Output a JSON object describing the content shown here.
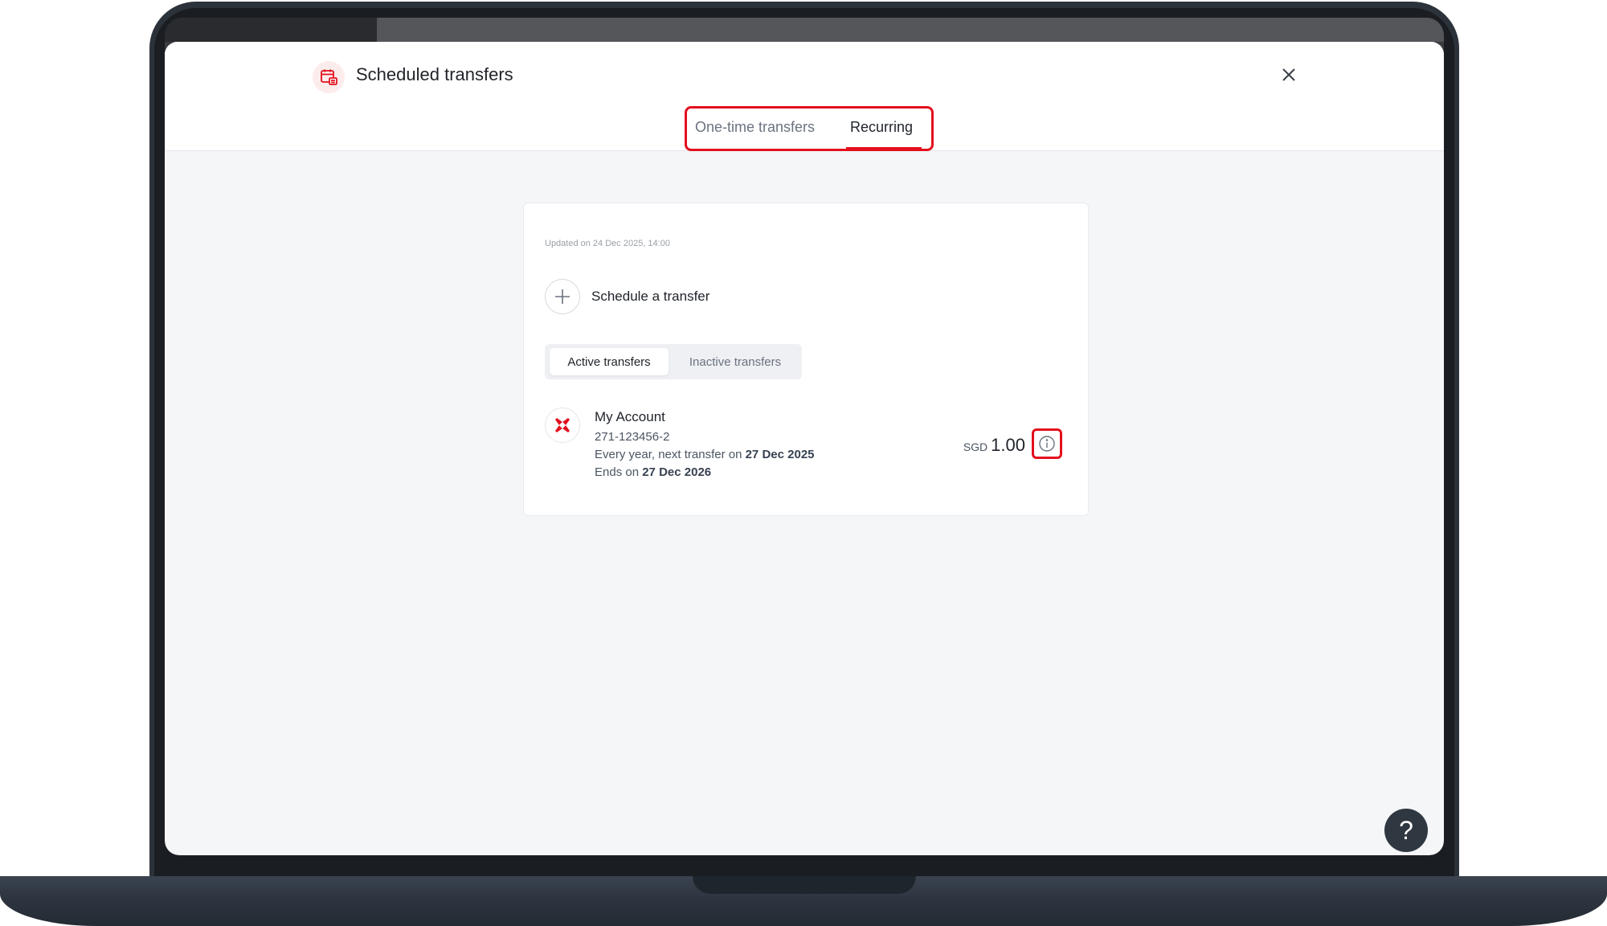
{
  "header": {
    "title": "Scheduled transfers",
    "icon": "calendar-transfer-icon",
    "close_icon": "close-icon"
  },
  "tabs": [
    {
      "label": "One-time transfers",
      "selected": false
    },
    {
      "label": "Recurring",
      "selected": true
    }
  ],
  "card": {
    "updated": "Updated on 24 Dec 2025, 14:00",
    "schedule_label": "Schedule a transfer",
    "segments": [
      {
        "label": "Active transfers",
        "selected": true
      },
      {
        "label": "Inactive transfers",
        "selected": false
      }
    ],
    "transfer": {
      "account_name": "My Account",
      "account_number": "271-123456-2",
      "frequency_prefix": "Every year, next transfer on ",
      "next_date": "27 Dec 2025",
      "ends_prefix": "Ends on ",
      "end_date": "27 Dec 2026",
      "currency": "SGD",
      "amount": "1.00"
    }
  },
  "help": {
    "label": "?"
  },
  "colors": {
    "accent": "#e3101d",
    "help_bg": "#2f3741"
  }
}
